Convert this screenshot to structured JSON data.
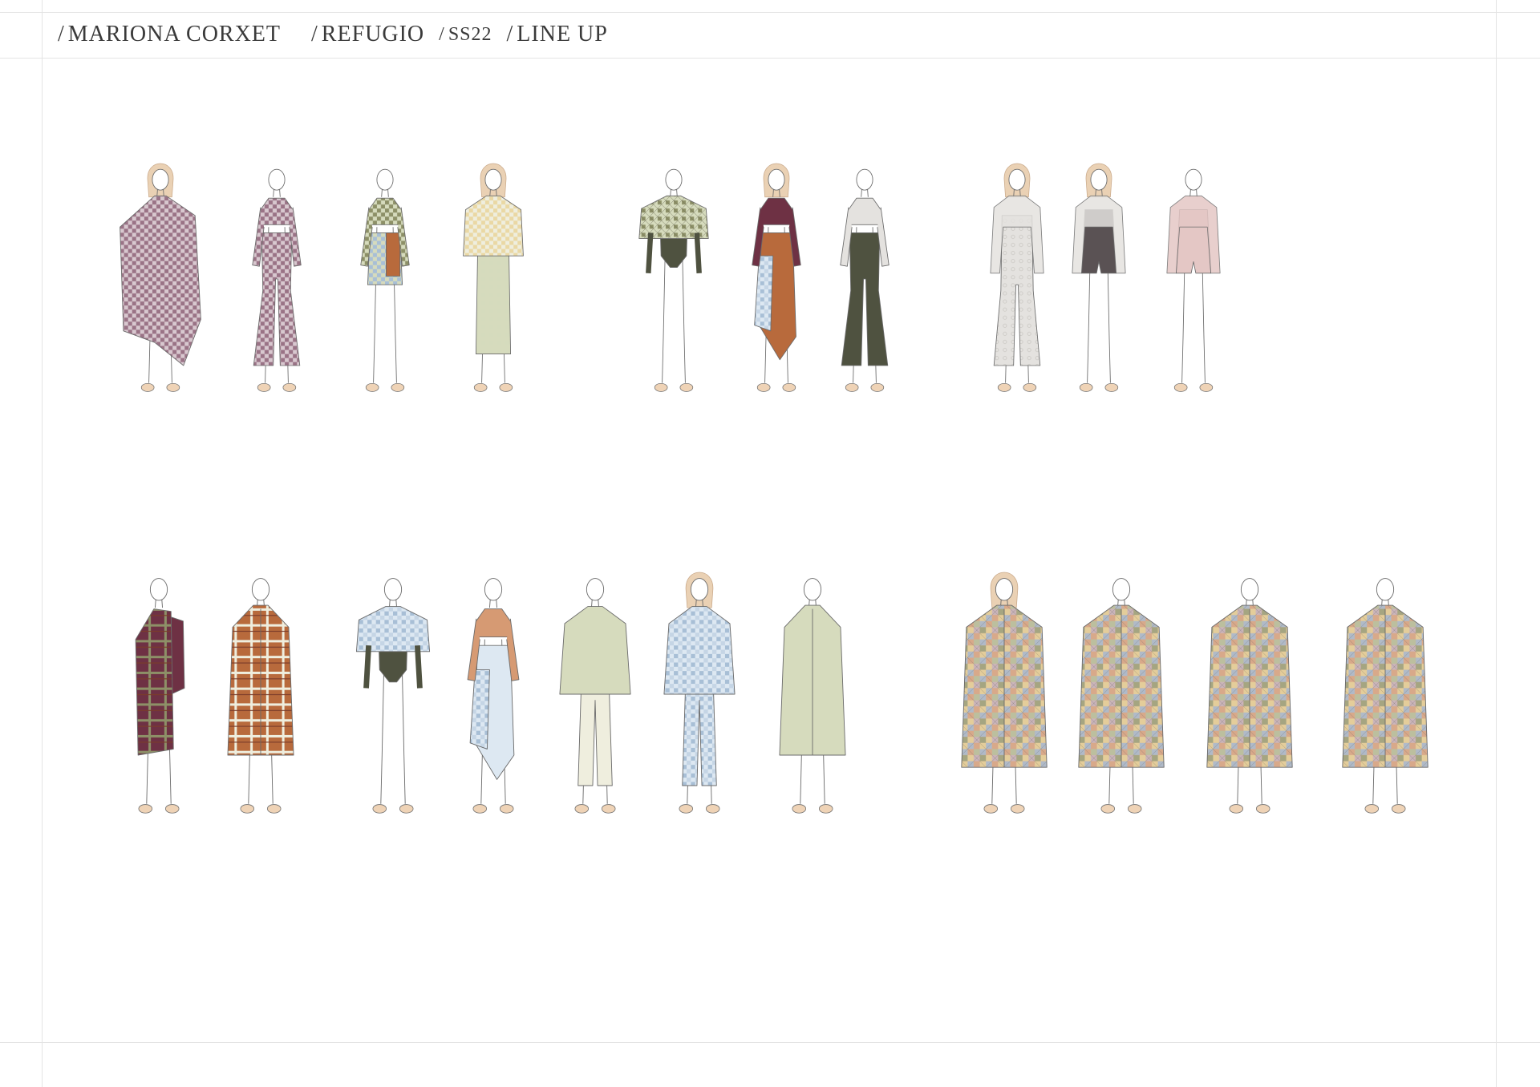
{
  "header": {
    "crumbs": [
      {
        "slash": "/",
        "text": "MARIONA CORXET"
      },
      {
        "slash": "/",
        "text": "REFUGIO"
      },
      {
        "slash": "/",
        "text": "SS22"
      },
      {
        "slash": "/",
        "text": "LINE UP"
      }
    ]
  },
  "palette": {
    "skin": "#efd3b6",
    "hair": "#ead1b4",
    "line": "#6b6b6b",
    "mauve": "#9a7386",
    "mauve_light": "#d8c8cf",
    "sage": "#8d9067",
    "sage_light": "#d6dbbd",
    "olive_dark": "#4f5240",
    "rust": "#b86a3c",
    "rust_light": "#d69a73",
    "sky": "#a8bfd6",
    "sky_light": "#dde8f2",
    "butter": "#ead8a4",
    "plum": "#6e3144",
    "cream": "#efeede",
    "charcoal": "#5a5254",
    "blush": "#e4c7c5",
    "lace": "#e4e2df",
    "patch_mix": [
      "#d9a98a",
      "#b7c3a1",
      "#a9bdd3",
      "#e6d49d",
      "#c9b7c2",
      "#9da57f"
    ]
  },
  "figures": {
    "row1": [
      {
        "name": "checked-cape-look",
        "top": "mauve",
        "top2": "mauve_light",
        "bottom": "mauve",
        "pattern": "check",
        "garment": "cape",
        "hair": true
      },
      {
        "name": "checked-flare-set-look",
        "top": "mauve",
        "top2": "mauve_light",
        "bottom": "mauve",
        "pattern": "check",
        "garment": "flare",
        "hair": false
      },
      {
        "name": "asymmetric-skirt-look",
        "top": "sage",
        "top2": "sage_light",
        "bottom": "sky",
        "pattern": "check",
        "garment": "skirt",
        "hair": false
      },
      {
        "name": "gingham-dress-look",
        "top": "butter",
        "top2": "sage_light",
        "bottom": "sage_light",
        "pattern": "gingham",
        "garment": "dress",
        "hair": true
      },
      {
        "name": "patch-cape-bodysuit-look",
        "top": "sage",
        "top2": "sage_light",
        "bottom": "olive_dark",
        "pattern": "patch",
        "garment": "body",
        "hair": false
      },
      {
        "name": "halter-wrap-skirt-look",
        "top": "plum",
        "top2": "mauve",
        "bottom": "rust",
        "pattern": "solid",
        "garment": "wrapskirt",
        "hair": true
      },
      {
        "name": "olive-flare-trouser-look",
        "top": "lace",
        "top2": "blush",
        "bottom": "olive_dark",
        "pattern": "solid",
        "garment": "flare",
        "hair": false
      },
      {
        "name": "lace-jumpsuit-look",
        "top": "lace",
        "top2": "lace",
        "bottom": "lace",
        "pattern": "lace",
        "garment": "jumpsuit",
        "hair": true
      },
      {
        "name": "charcoal-overall-look",
        "top": "lace",
        "top2": "lace",
        "bottom": "charcoal",
        "pattern": "solid",
        "garment": "overall",
        "hair": true
      },
      {
        "name": "blush-playsuit-look",
        "top": "blush",
        "top2": "blush",
        "bottom": "blush",
        "pattern": "check",
        "garment": "playsuit",
        "hair": false
      }
    ],
    "row2": [
      {
        "name": "plaid-scarf-look",
        "top": "sage",
        "top2": "plum",
        "bottom": "sage",
        "pattern": "plaid",
        "garment": "scarf",
        "hair": false
      },
      {
        "name": "plaid-trench-look",
        "top": "cream",
        "top2": "rust",
        "bottom": "cream",
        "pattern": "plaid",
        "garment": "coat",
        "hair": false
      },
      {
        "name": "gingham-bodysuit-look",
        "top": "sky",
        "top2": "sky_light",
        "bottom": "olive_dark",
        "pattern": "gingham",
        "garment": "body",
        "hair": false
      },
      {
        "name": "rust-wrap-look",
        "top": "rust_light",
        "top2": "rust",
        "bottom": "sky_light",
        "pattern": "solid",
        "garment": "wrapskirt",
        "hair": false
      },
      {
        "name": "sage-jacket-look",
        "top": "sage_light",
        "top2": "cream",
        "bottom": "cream",
        "pattern": "solid",
        "garment": "jacket",
        "hair": false
      },
      {
        "name": "gingham-jacket-look",
        "top": "sky",
        "top2": "sky_light",
        "bottom": "sky",
        "pattern": "gingham",
        "garment": "jacket",
        "hair": true
      },
      {
        "name": "quilted-coat-look",
        "top": "sage_light",
        "top2": "cream",
        "bottom": "sage_light",
        "pattern": "solid",
        "garment": "coat",
        "hair": false
      },
      {
        "name": "patchwork-hooded-look",
        "top": "patch",
        "top2": "patch",
        "bottom": "patch",
        "pattern": "patchwork",
        "garment": "bigcoat",
        "hair": true
      },
      {
        "name": "patchwork-parka-look",
        "top": "patch",
        "top2": "patch",
        "bottom": "patch",
        "pattern": "patchwork",
        "garment": "bigcoat",
        "hair": false
      },
      {
        "name": "patchwork-cocoon-look",
        "top": "patch",
        "top2": "patch",
        "bottom": "patch",
        "pattern": "patchwork",
        "garment": "bigcoat",
        "hair": false
      },
      {
        "name": "patchwork-oversized-look",
        "top": "patch",
        "top2": "patch",
        "bottom": "patch",
        "pattern": "patchwork",
        "garment": "bigcoat",
        "hair": false
      }
    ]
  }
}
